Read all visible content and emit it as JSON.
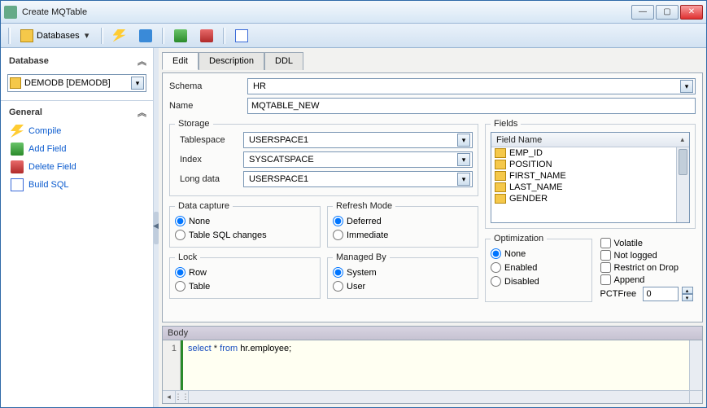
{
  "window": {
    "title": "Create MQTable"
  },
  "toolbar": {
    "databases_label": "Databases"
  },
  "sidebar": {
    "database_header": "Database",
    "general_header": "General",
    "database_selected": "DEMODB [DEMODB]",
    "items": [
      {
        "label": "Compile"
      },
      {
        "label": "Add Field"
      },
      {
        "label": "Delete Field"
      },
      {
        "label": "Build SQL"
      }
    ]
  },
  "tabs": {
    "edit": "Edit",
    "description": "Description",
    "ddl": "DDL"
  },
  "form": {
    "schema_label": "Schema",
    "schema_value": "HR",
    "name_label": "Name",
    "name_value": "MQTABLE_NEW",
    "storage": {
      "legend": "Storage",
      "tablespace_label": "Tablespace",
      "tablespace_value": "USERSPACE1",
      "index_label": "Index",
      "index_value": "SYSCATSPACE",
      "longdata_label": "Long data",
      "longdata_value": "USERSPACE1"
    },
    "fields": {
      "legend": "Fields",
      "header": "Field Name",
      "items": [
        "EMP_ID",
        "POSITION",
        "FIRST_NAME",
        "LAST_NAME",
        "GENDER"
      ]
    },
    "data_capture": {
      "legend": "Data capture",
      "none": "None",
      "table_sql": "Table SQL changes",
      "selected": "none"
    },
    "refresh_mode": {
      "legend": "Refresh Mode",
      "deferred": "Deferred",
      "immediate": "Immediate",
      "selected": "deferred"
    },
    "lock": {
      "legend": "Lock",
      "row": "Row",
      "table": "Table",
      "selected": "row"
    },
    "managed_by": {
      "legend": "Managed By",
      "system": "System",
      "user": "User",
      "selected": "system"
    },
    "optimization": {
      "legend": "Optimization",
      "none": "None",
      "enabled": "Enabled",
      "disabled": "Disabled",
      "selected": "none"
    },
    "flags": {
      "volatile": "Volatile",
      "not_logged": "Not logged",
      "restrict_drop": "Restrict on Drop",
      "append": "Append",
      "pctfree_label": "PCTFree",
      "pctfree_value": "0"
    }
  },
  "body": {
    "legend": "Body",
    "line_no": "1",
    "sql_select": "select",
    "sql_star": " * ",
    "sql_from": "from",
    "sql_rest": " hr.employee;"
  }
}
